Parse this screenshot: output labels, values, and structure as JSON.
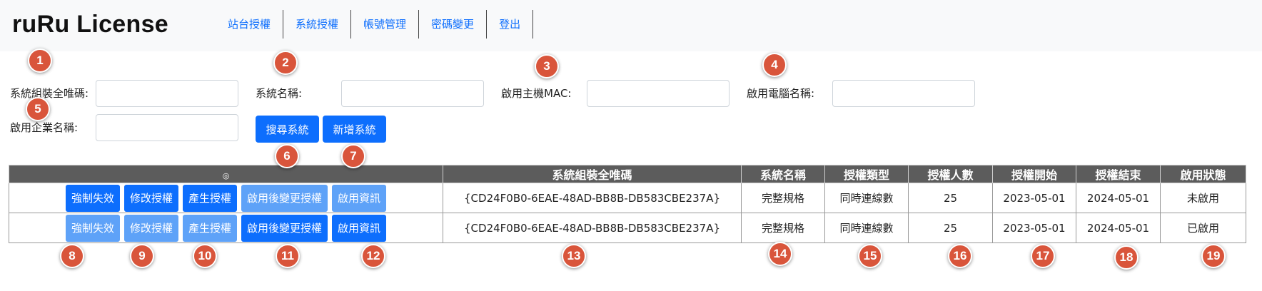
{
  "app": {
    "brand": "ruRu License"
  },
  "nav": {
    "items": [
      {
        "label": "站台授權"
      },
      {
        "label": "系統授權"
      },
      {
        "label": "帳號管理"
      },
      {
        "label": "密碼變更"
      },
      {
        "label": "登出"
      }
    ]
  },
  "search": {
    "fields": [
      {
        "label": "系統組裝全唯碼:",
        "value": ""
      },
      {
        "label": "系統名稱:",
        "value": ""
      },
      {
        "label": "啟用主機MAC:",
        "value": ""
      },
      {
        "label": "啟用電腦名稱:",
        "value": ""
      },
      {
        "label": "啟用企業名稱:",
        "value": ""
      }
    ],
    "search_button": "搜尋系統",
    "add_button": "新增系統"
  },
  "table": {
    "sort_icon": "◎",
    "headers": [
      "系統組裝全唯碼",
      "系統名稱",
      "授權類型",
      "授權人數",
      "授權開始",
      "授權結束",
      "啟用狀態"
    ],
    "action_labels": [
      "強制失效",
      "修改授權",
      "產生授權",
      "啟用後變更授權",
      "啟用資訊"
    ],
    "rows": [
      {
        "id": "{CD24F0B0-6EAE-48AD-BB8B-DB583CBE237A}",
        "name": "完整規格",
        "type": "同時連線數",
        "count": "25",
        "start": "2023-05-01",
        "end": "2024-05-01",
        "status": "未啟用",
        "button_states": [
          "enabled",
          "enabled",
          "enabled",
          "disabled",
          "disabled"
        ]
      },
      {
        "id": "{CD24F0B0-6EAE-48AD-BB8B-DB583CBE237A}",
        "name": "完整規格",
        "type": "同時連線數",
        "count": "25",
        "start": "2023-05-01",
        "end": "2024-05-01",
        "status": "已啟用",
        "button_states": [
          "disabled",
          "disabled",
          "disabled",
          "enabled",
          "enabled"
        ]
      }
    ]
  },
  "markers": [
    "1",
    "2",
    "3",
    "4",
    "5",
    "6",
    "7",
    "8",
    "9",
    "10",
    "11",
    "12",
    "13",
    "14",
    "15",
    "16",
    "17",
    "18",
    "19"
  ],
  "colors": {
    "primary": "#0d6efd",
    "primary_disabled": "#5ea2f8",
    "marker": "#d9553b",
    "table_header": "#5c5c5c",
    "navbar": "#f8f9fa"
  }
}
